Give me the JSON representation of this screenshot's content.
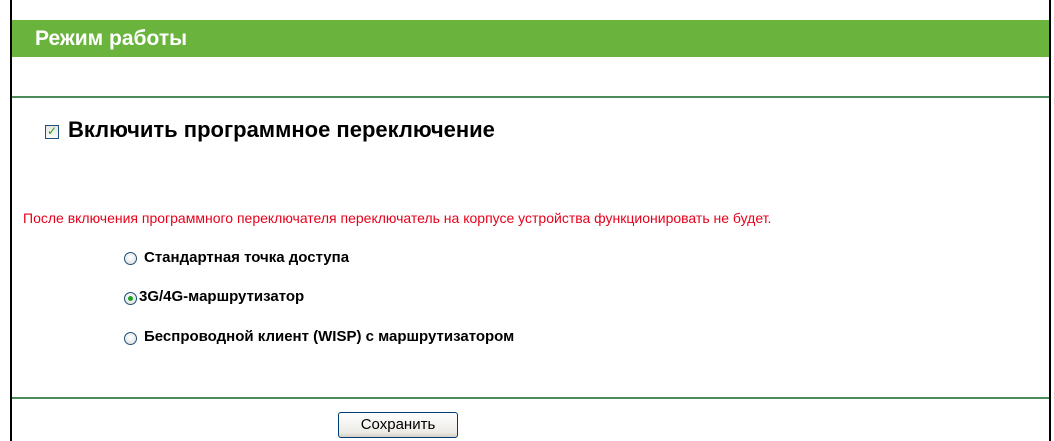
{
  "header": {
    "title": "Режим работы",
    "color": "#6ab43e"
  },
  "software_switch": {
    "label": "Включить программное переключение",
    "checked": true
  },
  "warning": {
    "text": "После включения программного переключателя переключатель на корпусе устройства функционировать не будет.",
    "color": "#e8001b"
  },
  "modes": {
    "options": [
      {
        "label": "Стандартная точка доступа",
        "selected": false
      },
      {
        "label": "3G/4G-маршрутизатор",
        "selected": true
      },
      {
        "label": "Беспроводной клиент (WISP) с маршрутизатором",
        "selected": false
      }
    ]
  },
  "actions": {
    "save_label": "Сохранить"
  },
  "colors": {
    "divider": "#4a8c5c",
    "control_mark": "#21a121"
  }
}
